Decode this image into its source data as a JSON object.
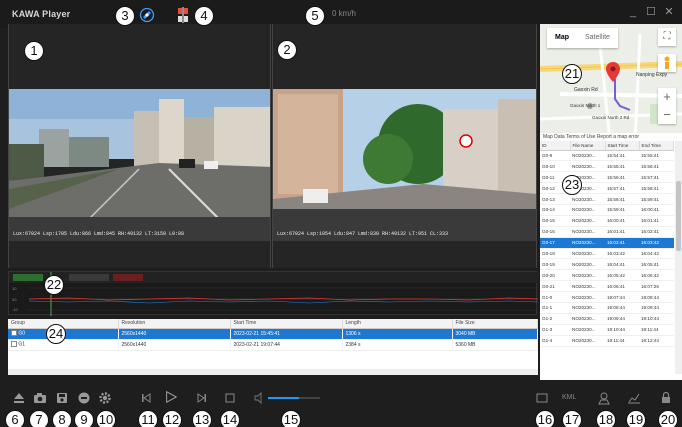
{
  "app": {
    "title": "KAWA Player",
    "speed": "0 km/h"
  },
  "callouts": [
    "1",
    "2",
    "3",
    "4",
    "5",
    "6",
    "7",
    "8",
    "9",
    "10",
    "11",
    "12",
    "13",
    "14",
    "15",
    "16",
    "17",
    "18",
    "19",
    "20",
    "21",
    "22",
    "23",
    "24"
  ],
  "video": {
    "front_osd": "Lux:67024  Lsp:1705  Ldu:866  Lmd:845  RH:49132  LT:3150  L0:88",
    "rear_osd": "Lux:67024  Lsp:1054  Ldu:847  Lmd:830  RH:49132  LT:951  CL:333"
  },
  "timeline": {
    "y_ticks": [
      "10",
      "00",
      "-10"
    ]
  },
  "file_table": {
    "columns": [
      "Group",
      "Resolution",
      "Start Time",
      "Length",
      "File Size"
    ],
    "rows": [
      {
        "group": "G0",
        "resolution": "2560x1440",
        "start": "2023-02-21 15:45:41",
        "length": "1306 s",
        "size": "3040 MB",
        "selected": true
      },
      {
        "group": "G1",
        "resolution": "2560x1440",
        "start": "2023-02-21 19:07:44",
        "length": "2384 s",
        "size": "5360 MB",
        "selected": false
      }
    ]
  },
  "map": {
    "tab_map": "Map",
    "tab_satellite": "Satellite",
    "label_road1": "Nanping Expy",
    "label_road2": "Gaoxin Rd",
    "label_poi1": "Gaoxin North 1",
    "label_poi2": "Gaoxin North 2 Rd",
    "footer": "Map Data   Terms of Use   Report a map error",
    "zoom_in": "+",
    "zoom_out": "−",
    "accent": "#1e78d2",
    "pin_color": "#e53935"
  },
  "segments": {
    "columns": [
      "ID",
      "File Name",
      "Start Time",
      "End Time"
    ],
    "rows": [
      [
        "G0-9",
        "NO20230...",
        "15:54:41",
        "15:55:41"
      ],
      [
        "G0-10",
        "NO20230...",
        "15:55:41",
        "15:56:41"
      ],
      [
        "G0-11",
        "NO20230...",
        "15:56:41",
        "15:57:41"
      ],
      [
        "G0-12",
        "NO20230...",
        "15:57:41",
        "15:58:41"
      ],
      [
        "G0-13",
        "NO20230...",
        "15:58:41",
        "15:59:41"
      ],
      [
        "G0-14",
        "NO20230...",
        "15:59:41",
        "16:00:41"
      ],
      [
        "G0-15",
        "NO20230...",
        "16:00:41",
        "16:01:41"
      ],
      [
        "G0-16",
        "NO20230...",
        "16:01:41",
        "16:02:41"
      ],
      [
        "G0-17",
        "NO20230...",
        "16:02:41",
        "16:03:42"
      ],
      [
        "G0-18",
        "NO20230...",
        "16:03:42",
        "16:04:42"
      ],
      [
        "G0-19",
        "NO20230...",
        "16:04:41",
        "16:05:41"
      ],
      [
        "G0-20",
        "NO20230...",
        "16:05:42",
        "16:06:42"
      ],
      [
        "G0-21",
        "NO20230...",
        "16:06:41",
        "16:07:26"
      ],
      [
        "G1-0",
        "NO20230...",
        "19:07:44",
        "19:08:44"
      ],
      [
        "G1-1",
        "NO20230...",
        "19:08:44",
        "19:09:44"
      ],
      [
        "G1-2",
        "NO20230...",
        "19:09:44",
        "19:10:44"
      ],
      [
        "G1-3",
        "NO20230...",
        "19:10:44",
        "19:11:44"
      ],
      [
        "G1-4",
        "NO20230...",
        "19:11:44",
        "19:12:44"
      ]
    ],
    "selected_index": 8
  },
  "toolbar": {
    "kml_label": "KML",
    "volume_level": 0.6
  },
  "icons": [
    "eject-icon",
    "camera-icon",
    "save-icon",
    "minus-circle-icon",
    "gear-icon",
    "skip-back-icon",
    "play-icon",
    "skip-forward-icon",
    "stop-icon",
    "volume-icon",
    "fullscreen-icon",
    "kml-icon",
    "user-location-icon",
    "chart-icon",
    "lock-icon",
    "satellite-icon",
    "car-split-icon"
  ]
}
